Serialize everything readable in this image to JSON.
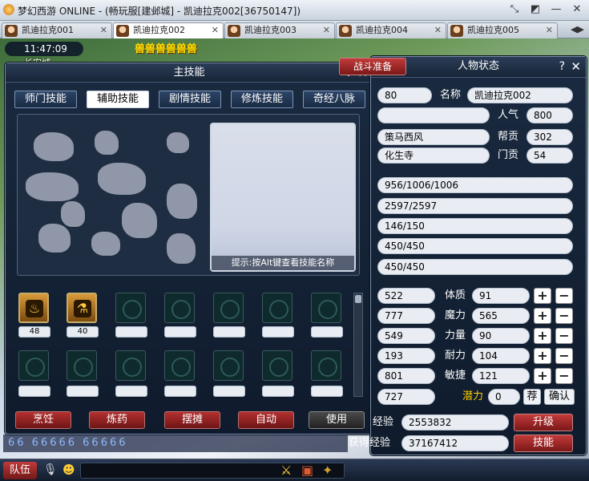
{
  "window": {
    "title": "梦幻西游 ONLINE - (畅玩服[建邺城] - 凯迪拉克002[36750147])"
  },
  "tabs": [
    {
      "label": "凯迪拉克001"
    },
    {
      "label": "凯迪拉克002"
    },
    {
      "label": "凯迪拉克003"
    },
    {
      "label": "凯迪拉克004"
    },
    {
      "label": "凯迪拉克005"
    }
  ],
  "hud": {
    "time": "11:47:09",
    "city": "长安城",
    "banner": "兽兽兽兽兽兽"
  },
  "skills_window": {
    "title": "主技能",
    "help": "?",
    "close": "✕",
    "tabs": [
      "师门技能",
      "辅助技能",
      "剧情技能",
      "修炼技能",
      "奇经八脉"
    ],
    "active_tab": "辅助技能",
    "hint": "提示:按Alt键查看技能名称",
    "learned": [
      {
        "icon": "cooking-icon",
        "level": "48"
      },
      {
        "icon": "alchemy-icon",
        "level": "40"
      }
    ],
    "buttons": [
      "烹饪",
      "炼药",
      "摆摊",
      "自动",
      "使用"
    ]
  },
  "status_window": {
    "title": "人物状态",
    "tab_left": "战斗准备",
    "help": "?",
    "close": "✕",
    "level": "80",
    "name_label": "名称",
    "name": "凯迪拉克002",
    "popularity_label": "人气",
    "popularity": "800",
    "title_value": "策马西风",
    "gang_contrib_label": "帮贡",
    "gang_contrib": "302",
    "school": "化生寺",
    "school_contrib_label": "门贡",
    "school_contrib": "54",
    "hp": "956/1006/1006",
    "mp": "2597/2597",
    "anger": "146/150",
    "vigor": "450/450",
    "energy": "450/450",
    "stats": [
      {
        "value": "522",
        "label": "体质",
        "points": "91"
      },
      {
        "value": "777",
        "label": "魔力",
        "points": "565"
      },
      {
        "value": "549",
        "label": "力量",
        "points": "90"
      },
      {
        "value": "193",
        "label": "耐力",
        "points": "104"
      },
      {
        "value": "801",
        "label": "敏捷",
        "points": "121"
      }
    ],
    "bottom_value": "727",
    "potential_label": "潜力",
    "potential": "0",
    "recommend_btn": "荐",
    "confirm_btn": "确认",
    "exp_label": "经验",
    "exp": "2553832",
    "upgrade_btn": "升级",
    "gained_exp_label": "获得经验",
    "gained_exp": "37167412",
    "skills_btn": "技能"
  },
  "chat": {
    "text": "66 66666 66666"
  },
  "bottom": {
    "team": "队伍"
  }
}
